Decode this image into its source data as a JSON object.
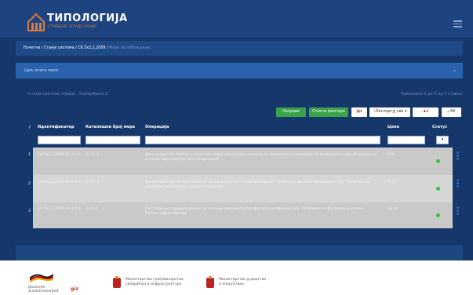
{
  "header": {
    "brand": "ТИПОЛОГИЈА",
    "brand_sub": "СТАМБЕНЕ ЗГРАДЕ СРБИЈЕ",
    "menu_icon": "hamburger-icon",
    "logo_icon": "house-logo-icon"
  },
  "breadcrumb": {
    "items": [
      "Почетна",
      "Станје система",
      "C6.5x2,2,2009"
    ],
    "current": "Мере за побољшање"
  },
  "filter_bar": {
    "label": "Циљ описа мере"
  },
  "info": {
    "left": "Станје система зграде : Унапређено 2",
    "right": "Приказано 1 до 3 од 3 ставки"
  },
  "toolbar": {
    "add_label": "Направи",
    "clear_label": "Очисти филтере",
    "menu_label": "▾",
    "export_label": "Експортуј све ▾",
    "col_label": "▾",
    "all_label": "All"
  },
  "table": {
    "headers": [
      "Идентификатор",
      "Каталошки број мере",
      "Операција",
      "Цена",
      "Статус"
    ],
    "rows": [
      {
        "num": "1",
        "id": "C6.5x2,2,2009-01-2.0-1",
        "catalog": "2.1.0 -1",
        "op": "Демонтажа постојећих и монтажа нових двоструких прозора са топлотном изолацијом на ваздушном слоју (Уградња на спољни зид) (енергетско оптерећење)",
        "price": "1.85"
      },
      {
        "num": "2",
        "id": "C6.5x2,2,2009-02-0.0-1",
        "catalog": "2.4.0 -1",
        "op": "Демонтажа постојећих спољних окова и монтажа нових фасадних столарија у високом фасадном слоју. Поправка на зидовима (постојеће) (заштитни радови)",
        "price": "9.75"
      },
      {
        "num": "3",
        "id": "C6.5x2,2,2009-03-1.0-1",
        "catalog": "3.1.0-1",
        "op": "Постављање термоизолације на спољни зид (контактна фасада) и завршни слој. Поправка на фасадама и основи. Пројектовање фасаде",
        "price": "18.14"
      }
    ]
  },
  "footer": {
    "logos": [
      {
        "text": "Deutsche Zusammenarbeit",
        "sub": "giz"
      },
      {
        "text": "Министарство грађевинарства,",
        "sub": "саобраћаја и инфраструктуре"
      },
      {
        "text": "Министарство рударства",
        "sub": "и енергетике"
      }
    ]
  },
  "colors": {
    "app_bg": "#16376a",
    "topbar": "#1d4380",
    "accent_green": "#3aa34a",
    "brand_orange": "#d97b3f"
  }
}
